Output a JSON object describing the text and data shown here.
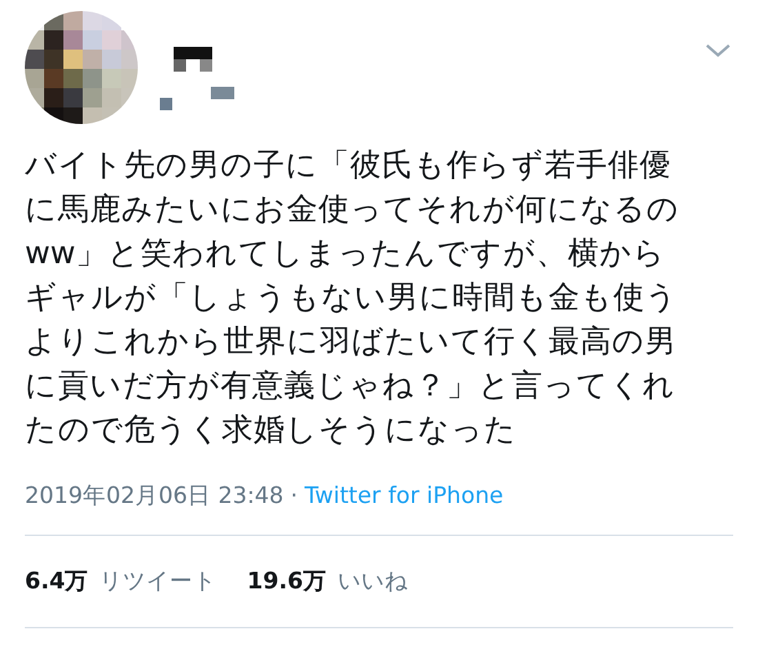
{
  "tweet": {
    "text_lines": [
      "バイト先の男の子に「彼氏も作らず若手俳優",
      "に馬鹿みたいにお金使ってそれが何になるの",
      "ww」と笑われてしまったんですが、横から",
      "ギャルが「しょうもない男に時間も金も使う",
      "よりこれから世界に羽ばたいて行く最高の男",
      "に貢いだ方が有意義じゃね？」と言ってくれ",
      "たので危うく求婚しそうになった"
    ],
    "timestamp": "2019年02月06日 23:48",
    "separator": "·",
    "source": "Twitter for iPhone",
    "stats": [
      {
        "count": "6.4万",
        "label": "リツイート"
      },
      {
        "count": "19.6万",
        "label": "いいね"
      }
    ]
  }
}
